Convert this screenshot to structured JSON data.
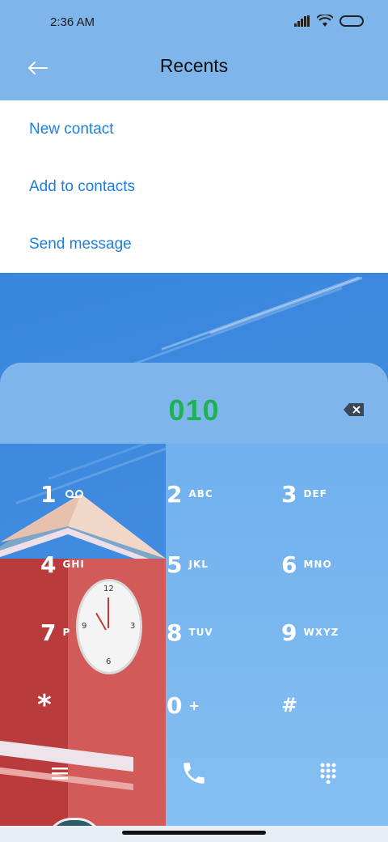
{
  "status_bar": {
    "time": "2:36 AM"
  },
  "app_bar": {
    "title": "Recents"
  },
  "menu": {
    "items": [
      {
        "label": "New contact"
      },
      {
        "label": "Add to contacts"
      },
      {
        "label": "Send message"
      }
    ]
  },
  "dialer": {
    "number": "010",
    "keys": [
      {
        "digit": "1",
        "letters": ""
      },
      {
        "digit": "2",
        "letters": "ABC"
      },
      {
        "digit": "3",
        "letters": "DEF"
      },
      {
        "digit": "4",
        "letters": "GHI"
      },
      {
        "digit": "5",
        "letters": "JKL"
      },
      {
        "digit": "6",
        "letters": "MNO"
      },
      {
        "digit": "7",
        "letters": "P"
      },
      {
        "digit": "8",
        "letters": "TUV"
      },
      {
        "digit": "9",
        "letters": "WXYZ"
      },
      {
        "digit": "*",
        "letters": ""
      },
      {
        "digit": "0",
        "letters": "+"
      },
      {
        "digit": "#",
        "letters": ""
      }
    ]
  },
  "colors": {
    "accent": "#1b7fe0",
    "number": "#1fb05a",
    "bar": "#7eb6ec"
  }
}
